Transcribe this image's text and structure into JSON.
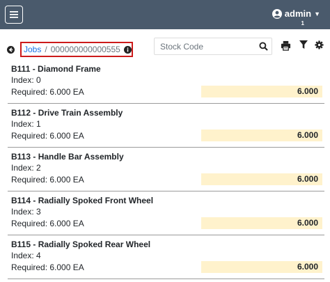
{
  "header": {
    "menu_icon": "hamburger-icon",
    "user_icon": "user-circle-icon",
    "username": "admin",
    "user_badge": "1",
    "bg_color": "#4a5a6c"
  },
  "toolbar": {
    "back_icon": "arrow-left-icon",
    "breadcrumb": {
      "link_label": "Jobs",
      "separator": "/",
      "job_number": "000000000000555",
      "info_icon": "info-circle-icon"
    },
    "search": {
      "placeholder": "Stock Code",
      "value": "",
      "icon": "search-icon"
    },
    "print_icon": "print-icon",
    "filter_icon": "filter-icon",
    "settings_icon": "gear-icon"
  },
  "items": [
    {
      "name": "B111 - Diamond Frame",
      "index": "Index: 0",
      "required": "Required: 6.000 EA",
      "quantity": "6.000"
    },
    {
      "name": "B112 - Drive Train Assembly",
      "index": "Index: 1",
      "required": "Required: 6.000 EA",
      "quantity": "6.000"
    },
    {
      "name": "B113 - Handle Bar Assembly",
      "index": "Index: 2",
      "required": "Required: 6.000 EA",
      "quantity": "6.000"
    },
    {
      "name": "B114 - Radially Spoked Front Wheel",
      "index": "Index: 3",
      "required": "Required: 6.000 EA",
      "quantity": "6.000"
    },
    {
      "name": "B115 - Radially Spoked Rear Wheel",
      "index": "Index: 4",
      "required": "Required: 6.000 EA",
      "quantity": "6.000"
    }
  ],
  "colors": {
    "quantity_highlight": "#fff2cc",
    "breadcrumb_border": "#cc1a1a",
    "link": "#1a73e8"
  }
}
